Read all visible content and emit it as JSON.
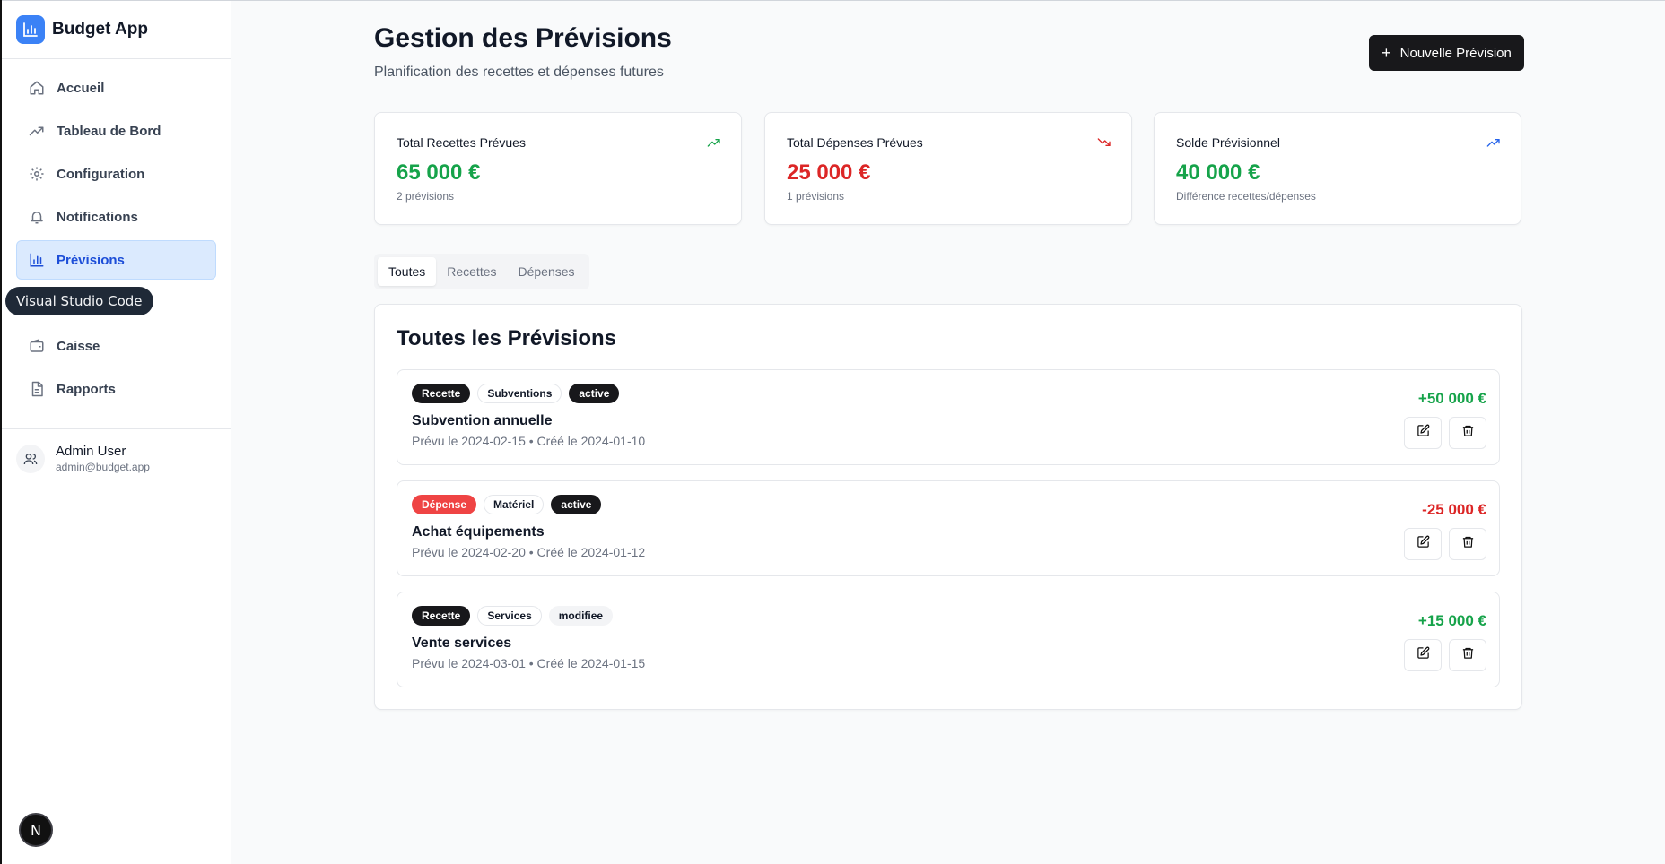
{
  "app": {
    "name": "Budget App"
  },
  "sidebar": {
    "items": [
      {
        "label": "Accueil",
        "icon": "home-icon"
      },
      {
        "label": "Tableau de Bord",
        "icon": "trending-up-icon"
      },
      {
        "label": "Configuration",
        "icon": "gear-icon"
      },
      {
        "label": "Notifications",
        "icon": "bell-icon"
      },
      {
        "label": "Prévisions",
        "icon": "bar-chart-icon",
        "active": true
      },
      {
        "label": "Caisse",
        "icon": "wallet-icon"
      },
      {
        "label": "Rapports",
        "icon": "document-icon"
      }
    ],
    "user": {
      "name": "Admin User",
      "email": "admin@budget.app"
    }
  },
  "tooltip": {
    "text": "Visual Studio Code"
  },
  "next_badge": {
    "letter": "N"
  },
  "header": {
    "title": "Gestion des Prévisions",
    "subtitle": "Planification des recettes et dépenses futures",
    "new_button": "Nouvelle Prévision"
  },
  "stats": [
    {
      "label": "Total Recettes Prévues",
      "value": "65 000 €",
      "sub": "2 prévisions",
      "color": "#16a34a",
      "icon": "trending-up-icon"
    },
    {
      "label": "Total Dépenses Prévues",
      "value": "25 000 €",
      "sub": "1 prévisions",
      "color": "#dc2626",
      "icon": "trending-down-icon"
    },
    {
      "label": "Solde Prévisionnel",
      "value": "40 000 €",
      "sub": "Différence recettes/dépenses",
      "color": "#16a34a",
      "icon": "trending-up-icon"
    }
  ],
  "tabs": [
    {
      "label": "Toutes",
      "active": true
    },
    {
      "label": "Recettes"
    },
    {
      "label": "Dépenses"
    }
  ],
  "list": {
    "title": "Toutes les Prévisions",
    "items": [
      {
        "type": "Recette",
        "category": "Subventions",
        "status": "active",
        "title": "Subvention annuelle",
        "meta": "Prévu le 2024-02-15 • Créé le 2024-01-10",
        "amount": "+50 000 €",
        "amount_color": "#16a34a"
      },
      {
        "type": "Dépense",
        "category": "Matériel",
        "status": "active",
        "title": "Achat équipements",
        "meta": "Prévu le 2024-02-20 • Créé le 2024-01-12",
        "amount": "-25 000 €",
        "amount_color": "#dc2626"
      },
      {
        "type": "Recette",
        "category": "Services",
        "status": "modifiee",
        "title": "Vente services",
        "meta": "Prévu le 2024-03-01 • Créé le 2024-01-15",
        "amount": "+15 000 €",
        "amount_color": "#16a34a"
      }
    ]
  },
  "colors": {
    "accent": "#3b82f6",
    "income": "#16a34a",
    "expense": "#dc2626",
    "active_nav_bg": "#dbeafe"
  }
}
